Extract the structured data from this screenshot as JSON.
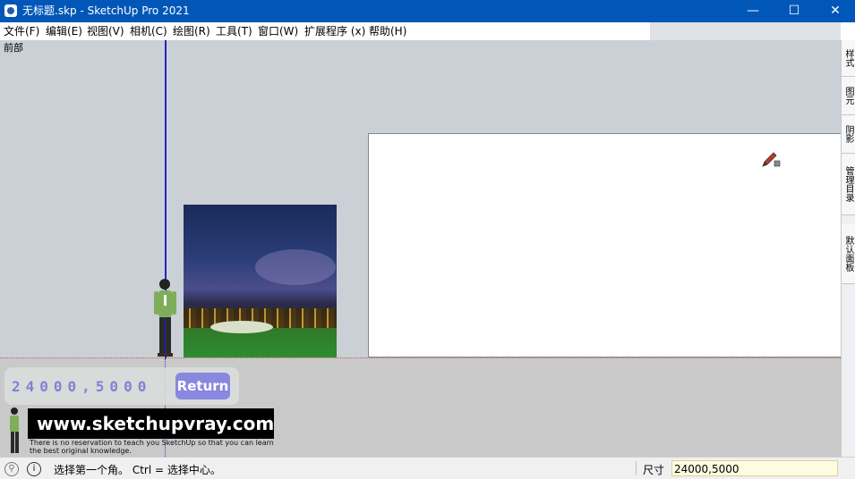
{
  "window": {
    "title": "无标题.skp - SketchUp Pro 2021",
    "app_icon": "sketchup-logo-icon",
    "minimize_glyph": "—",
    "maximize_glyph": "☐",
    "close_glyph": "✕"
  },
  "menu": {
    "items": [
      {
        "label": "文件(F)"
      },
      {
        "label": "编辑(E)"
      },
      {
        "label": "视图(V)"
      },
      {
        "label": "相机(C)"
      },
      {
        "label": "绘图(R)"
      },
      {
        "label": "工具(T)"
      },
      {
        "label": "窗口(W)"
      },
      {
        "label": "扩展程序 (x)"
      },
      {
        "label": "帮助(H)"
      }
    ]
  },
  "viewport": {
    "scene_label": "前部",
    "cursor_icon": "pencil-cursor-icon"
  },
  "tray": {
    "tabs": [
      {
        "label": "样式"
      },
      {
        "label": "图元"
      },
      {
        "label": "阴影"
      },
      {
        "label": "管理目录"
      },
      {
        "label": "默认面板"
      }
    ]
  },
  "overlay": {
    "vcb_echo": "24000,5000",
    "return_label": "Return",
    "banner_url": "www.sketchupvray.com",
    "tagline": "There is no reservation to teach you SketchUp so that you can learn the best original knowledge."
  },
  "status": {
    "geo_icon": "geolocation-icon",
    "info_icon": "info-icon",
    "hint": "选择第一个角。 Ctrl = 选择中心。",
    "dimension_label": "尺寸",
    "dimension_value": "24000,5000"
  },
  "colors": {
    "titlebar": "#0057b8",
    "viewport_sky": "#cbd0d6",
    "ground": "#c9c9c9",
    "blue_axis": "#2222c8",
    "vcb_field": "#fdfbe0",
    "return_button": "#8888e0"
  }
}
